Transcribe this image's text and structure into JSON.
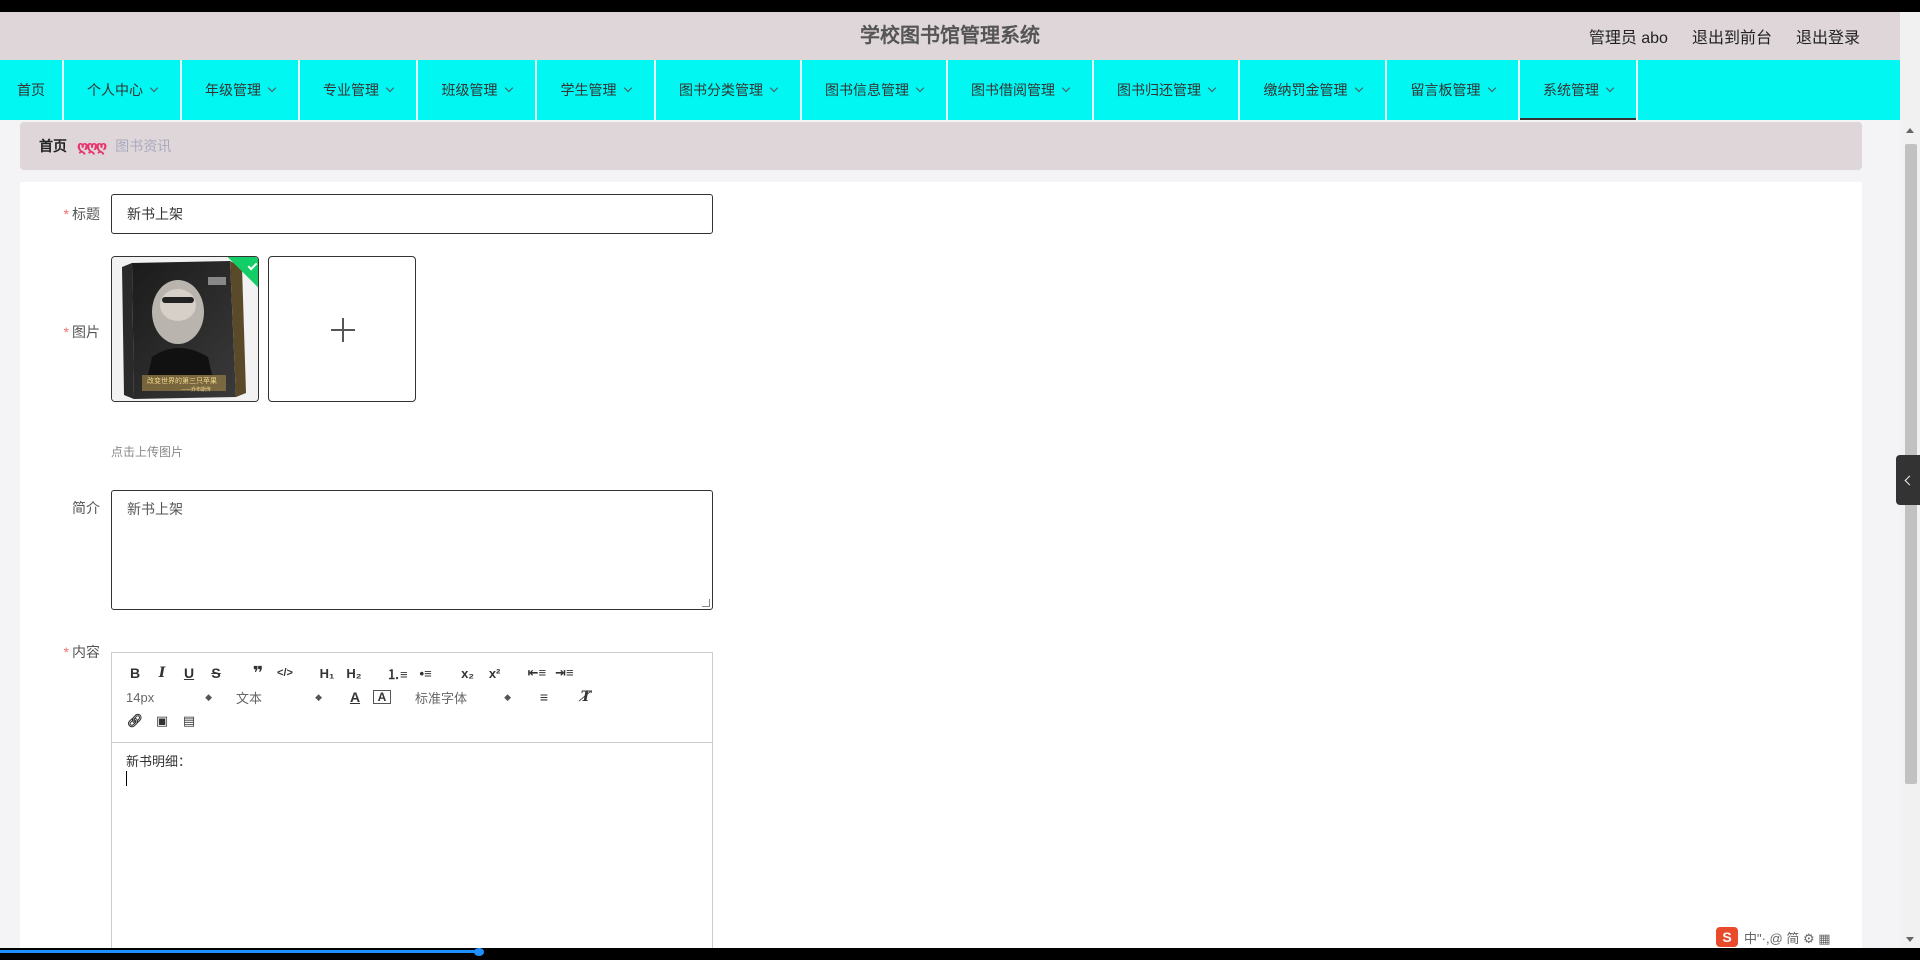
{
  "header": {
    "title": "学校图书馆管理系统",
    "user_label": "管理员 abo",
    "to_front": "退出到前台",
    "logout": "退出登录"
  },
  "nav": {
    "items": [
      {
        "label": "首页"
      },
      {
        "label": "个人中心"
      },
      {
        "label": "年级管理"
      },
      {
        "label": "专业管理"
      },
      {
        "label": "班级管理"
      },
      {
        "label": "学生管理"
      },
      {
        "label": "图书分类管理"
      },
      {
        "label": "图书信息管理"
      },
      {
        "label": "图书借阅管理"
      },
      {
        "label": "图书归还管理"
      },
      {
        "label": "缴纳罚金管理"
      },
      {
        "label": "留言板管理"
      },
      {
        "label": "系统管理"
      }
    ]
  },
  "breadcrumb": {
    "home": "首页",
    "separator": "ღღღ",
    "current": "图书资讯"
  },
  "form": {
    "title_label": "标题",
    "title_value": "新书上架",
    "image_label": "图片",
    "image_hint": "点击上传图片",
    "intro_label": "简介",
    "intro_value": "新书上架",
    "content_label": "内容",
    "required_mark": "*"
  },
  "book_cover": {
    "title_text": "改变世界的第三只苹果",
    "subtitle_text": "——乔布斯传"
  },
  "editor": {
    "font_size": "14px",
    "text_type": "文本",
    "font_family": "标准字体",
    "body_text": "新书明细："
  },
  "tray": {
    "logo": "S",
    "text": "中\"·,@ 简 ⚙ ▦"
  },
  "colors": {
    "nav_bg": "#00f7f2",
    "header_bg": "#ded6d8",
    "required": "#f56c6c",
    "success": "#13ce66"
  }
}
